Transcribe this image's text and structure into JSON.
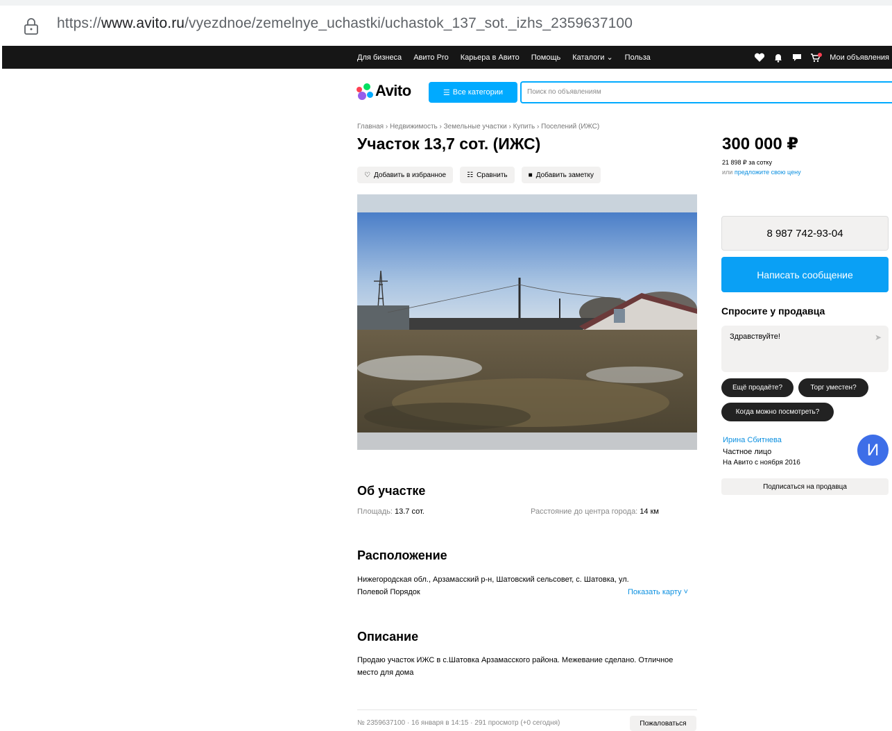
{
  "browser": {
    "url_prefix": "https://",
    "url_domain": "www.avito.ru",
    "url_path": "/vyezdnoe/zemelnye_uchastki/uchastok_137_sot._izhs_2359637100"
  },
  "topnav": {
    "links": [
      "Для бизнеса",
      "Авито Pro",
      "Карьера в Авито",
      "Помощь",
      "Каталоги ⌄",
      "Польза"
    ],
    "my_ads": "Мои объявления",
    "cart_badge": "1"
  },
  "header": {
    "logo_text": "Avito",
    "all_categories": "Все категории",
    "search_placeholder": "Поиск по объявлениям"
  },
  "breadcrumb": "Главная › Недвижимость › Земельные участки › Купить › Поселений (ИЖС)",
  "listing": {
    "title": "Участок 13,7 сот. (ИЖС)",
    "actions": {
      "favorite": "Добавить в избранное",
      "compare": "Сравнить",
      "note": "Добавить заметку"
    },
    "about": {
      "heading": "Об участке",
      "area_label": "Площадь:",
      "area_value": "13.7 сот.",
      "distance_label": "Расстояние до центра города:",
      "distance_value": "14 км"
    },
    "location": {
      "heading": "Расположение",
      "address": "Нижегородская обл., Арзамасский р-н, Шатовский сельсовет, с. Шатовка, ул. Полевой Порядок",
      "show_map": "Показать карту ˅"
    },
    "description": {
      "heading": "Описание",
      "text": "Продаю участок ИЖС в с.Шатовка Арзамасского района. Межевание сделано. Отличное место для дома"
    },
    "meta": "№ 2359637100 · 16 января в 14:15 · 291 просмотр (+0 сегодня)",
    "report": "Пожаловаться"
  },
  "sidebar": {
    "price": "300 000 ₽",
    "price_per": "21 898 ₽ за сотку",
    "offer_prefix": "или",
    "offer_link": "предложите свою цену",
    "phone": "8 987 742-93-04",
    "message_button": "Написать сообщение",
    "ask_heading": "Спросите у продавца",
    "ask_text": "Здравствуйте!",
    "chips": [
      "Ещё продаёте?",
      "Торг уместен?",
      "Когда можно посмотреть?"
    ],
    "seller_name": "Ирина Сбитнева",
    "seller_type": "Частное лицо",
    "seller_since": "На Авито с ноября 2016",
    "avatar_letter": "И",
    "subscribe": "Подписаться на продавца"
  }
}
